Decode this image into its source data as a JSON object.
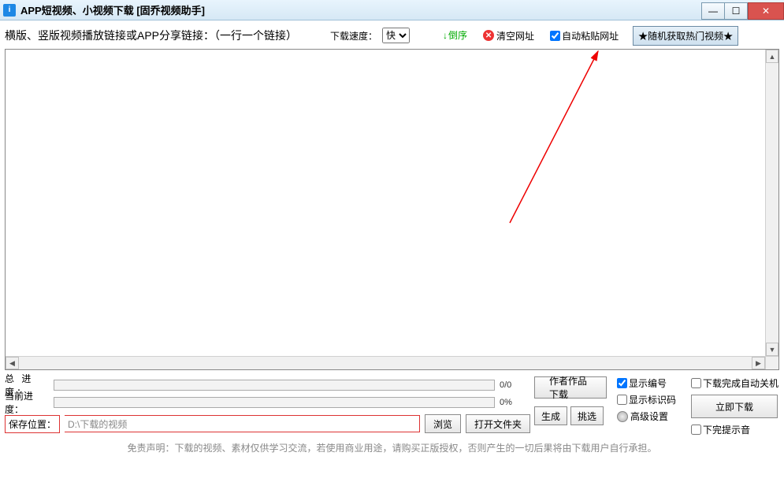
{
  "window": {
    "title": "APP短视频、小视频下载 [固乔视频助手]"
  },
  "toolbar": {
    "link_label": "横版、竖版视频播放链接或APP分享链接：（一行一个链接）",
    "speed_label": "下载速度：",
    "speed_value": "快",
    "sort_label": "倒序",
    "clear_label": "清空网址",
    "autopaste_label": "自动粘贴网址",
    "random_label": "★随机获取热门视频★"
  },
  "progress": {
    "total_label": "总 进 度：",
    "total_value": "0/0",
    "current_label": "当前进度：",
    "current_value": "0%"
  },
  "save": {
    "label": "保存位置：",
    "path": "D:\\下载的视频",
    "browse": "浏览",
    "open_folder": "打开文件夹",
    "generate": "生成",
    "pick": "挑选",
    "advanced": "高级设置"
  },
  "actions": {
    "author_works": "作者作品下载",
    "download_now": "立即下载"
  },
  "options": {
    "show_index": "显示编号",
    "show_code": "显示标识码",
    "shutdown_after": "下载完成自动关机",
    "sound_after": "下完提示音"
  },
  "footer": {
    "disclaimer": "免责声明：下载的视频、素材仅供学习交流，若使用商业用途，请购买正版授权，否则产生的一切后果将由下载用户自行承担。"
  }
}
